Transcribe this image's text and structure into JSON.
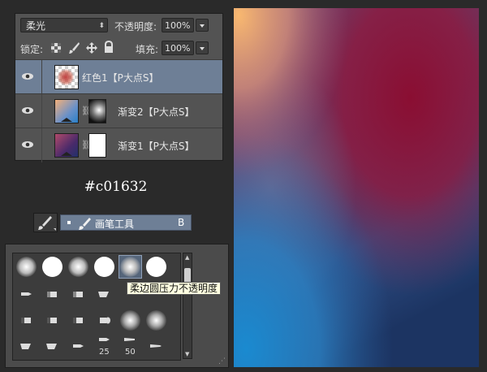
{
  "layers_panel": {
    "blend_mode": "柔光",
    "opacity_label": "不透明度:",
    "opacity_value": "100%",
    "lock_label": "锁定:",
    "fill_label": "填充:",
    "fill_value": "100%",
    "layers": [
      {
        "name": "红色1【P大点S】",
        "selected": true
      },
      {
        "name": "渐变2【P大点S】",
        "selected": false
      },
      {
        "name": "渐变1【P大点S】",
        "selected": false
      }
    ]
  },
  "color_note": "#c01632",
  "tool": {
    "name": "画笔工具",
    "shortcut": "B"
  },
  "brush_picker": {
    "tooltip": "柔边圆压力不透明度",
    "sizes": [
      "25",
      "50"
    ]
  },
  "colors": {
    "accent_red": "#c01632",
    "selection": "#6e7f96"
  }
}
